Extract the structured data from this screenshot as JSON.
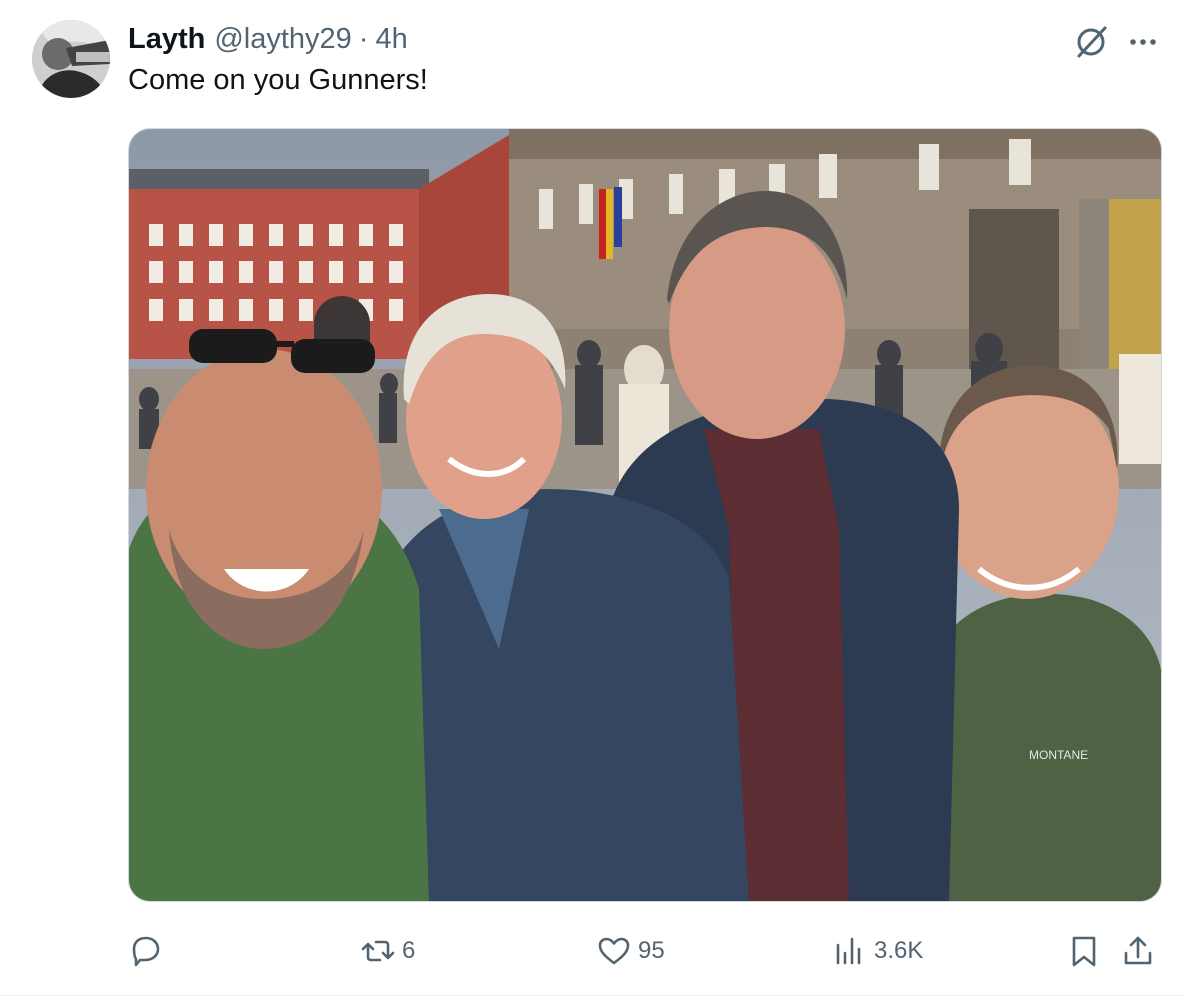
{
  "tweet": {
    "display_name": "Layth",
    "handle": "@laythy29",
    "separator": "·",
    "time": "4h",
    "text": "Come on you Gunners!"
  },
  "media": {
    "description_icon": "photo-of-four-men-selfie-in-plaza"
  },
  "actions": {
    "reply_count": "",
    "retweet_count": "6",
    "like_count": "95",
    "view_count": "3.6K"
  },
  "colors": {
    "text_primary": "#0f1419",
    "text_secondary": "#536471"
  },
  "icons": [
    "grok-icon",
    "more-icon",
    "reply-icon",
    "retweet-icon",
    "like-icon",
    "views-icon",
    "bookmark-icon",
    "share-icon"
  ]
}
